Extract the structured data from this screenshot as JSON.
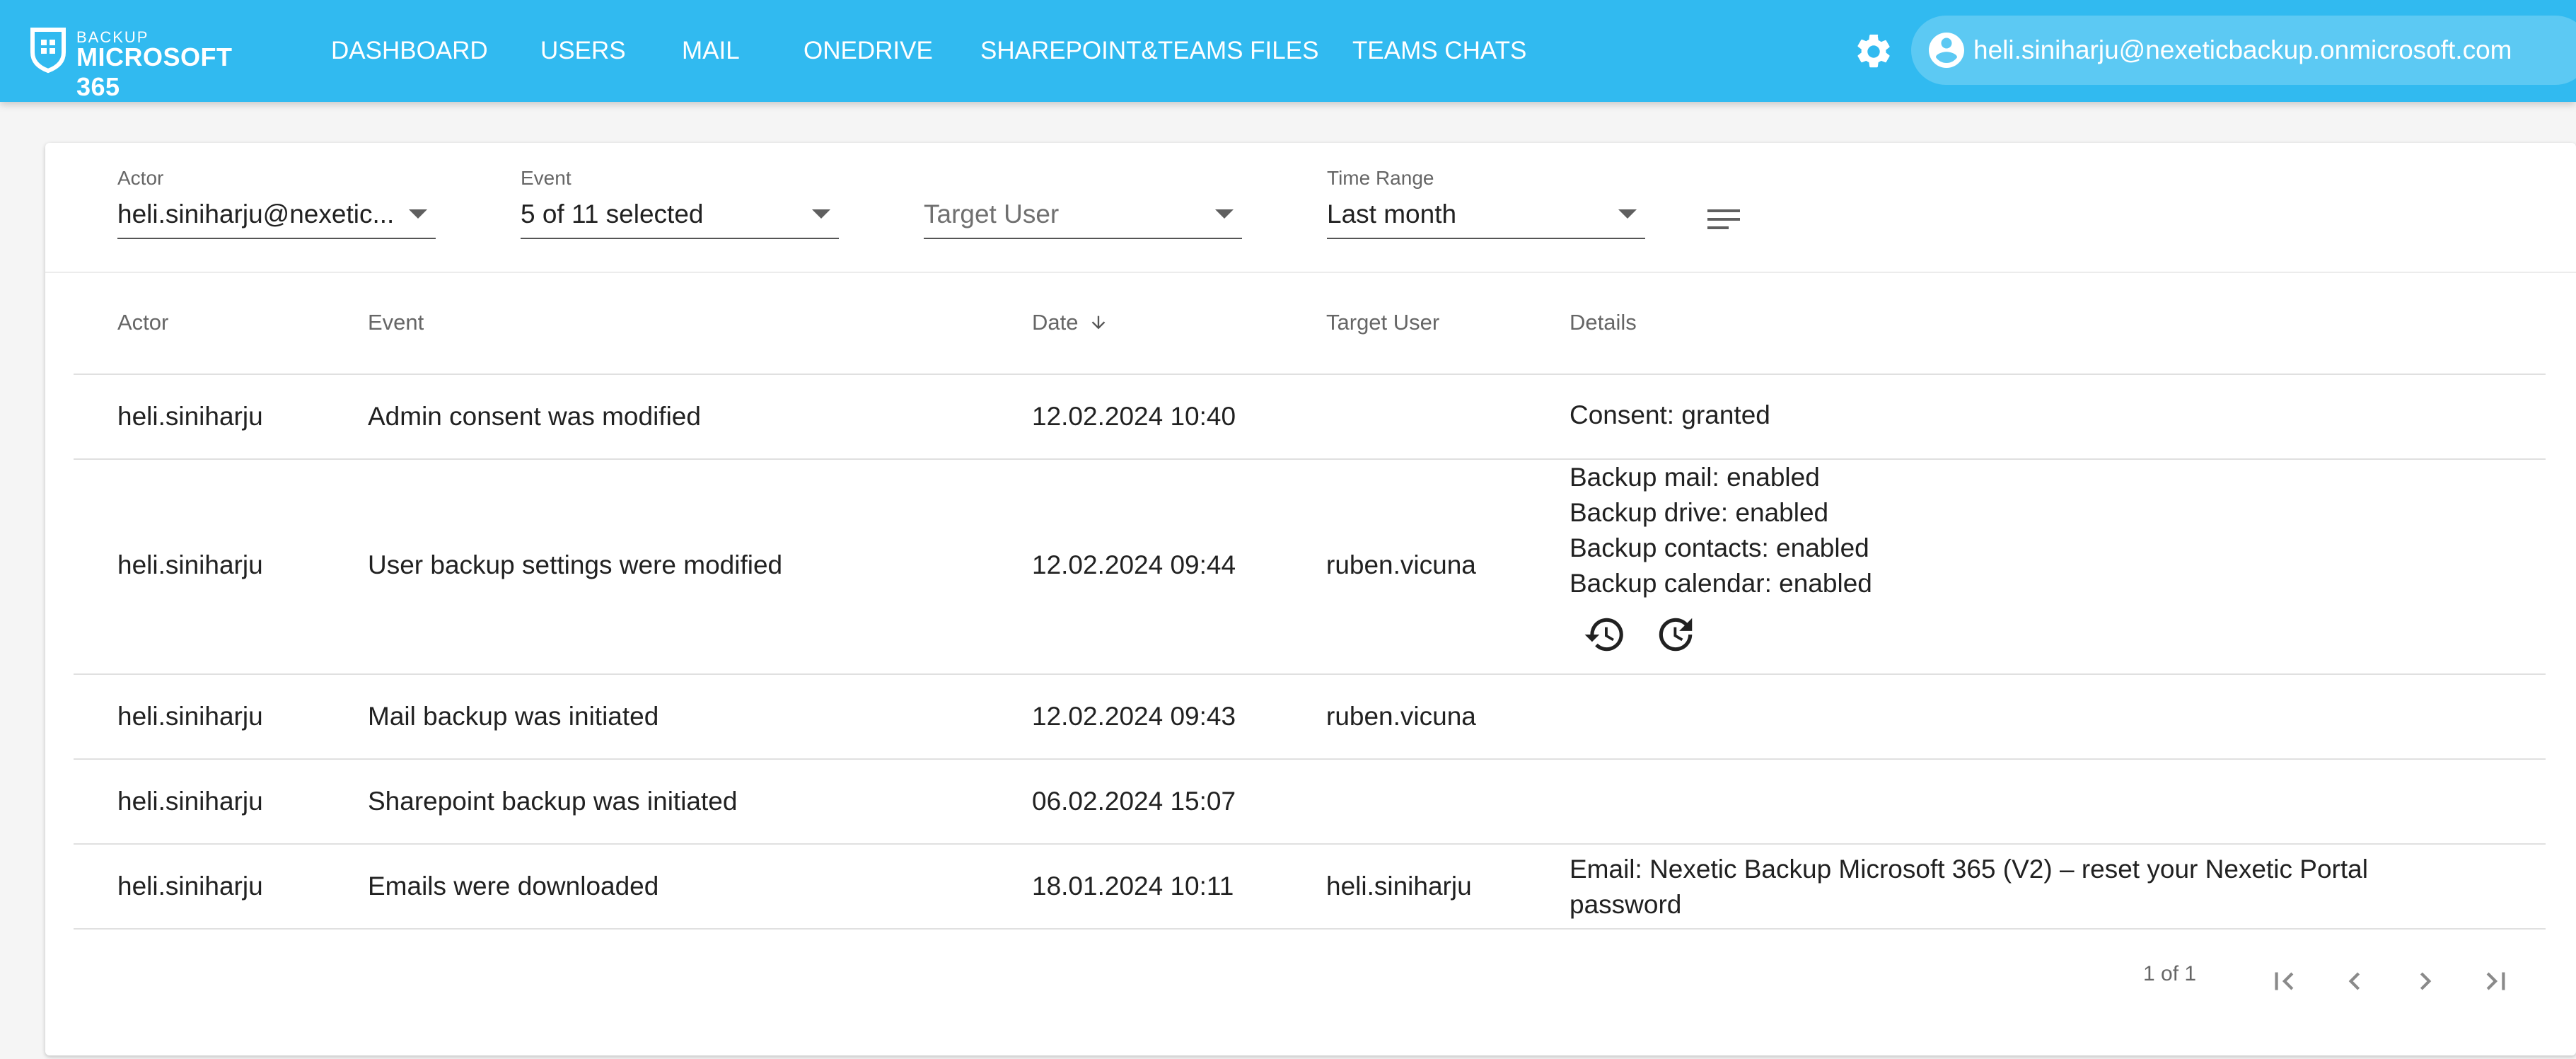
{
  "brand": {
    "sub": "BACKUP",
    "main": "MICROSOFT 365"
  },
  "nav": [
    "DASHBOARD",
    "USERS",
    "MAIL",
    "ONEDRIVE",
    "SHAREPOINT&TEAMS FILES",
    "TEAMS CHATS"
  ],
  "account": {
    "email": "heli.siniharju@nexeticbackup.onmicrosoft.com"
  },
  "filters": {
    "actor": {
      "label": "Actor",
      "value": "heli.siniharju@nexetic..."
    },
    "event": {
      "label": "Event",
      "value": "5 of 11 selected"
    },
    "target": {
      "label": "",
      "placeholder": "Target User"
    },
    "time": {
      "label": "Time Range",
      "value": "Last month"
    }
  },
  "table": {
    "headers": {
      "actor": "Actor",
      "event": "Event",
      "date": "Date",
      "target": "Target User",
      "details": "Details"
    },
    "sort_indicator": "arrow-down",
    "rows": [
      {
        "actor": "heli.siniharju",
        "event": "Admin consent was modified",
        "date": "12.02.2024 10:40",
        "target": "",
        "details": [
          "Consent: granted"
        ]
      },
      {
        "actor": "heli.siniharju",
        "event": "User backup settings were modified",
        "date": "12.02.2024 09:44",
        "target": "ruben.vicuna",
        "details": [
          "Backup mail: enabled",
          "Backup drive: enabled",
          "Backup contacts: enabled",
          "Backup calendar: enabled"
        ],
        "actions": [
          "history-icon",
          "restore-icon"
        ]
      },
      {
        "actor": "heli.siniharju",
        "event": "Mail backup was initiated",
        "date": "12.02.2024 09:43",
        "target": "ruben.vicuna",
        "details": []
      },
      {
        "actor": "heli.siniharju",
        "event": "Sharepoint backup was initiated",
        "date": "06.02.2024 15:07",
        "target": "",
        "details": []
      },
      {
        "actor": "heli.siniharju",
        "event": "Emails were downloaded",
        "date": "18.01.2024 10:11",
        "target": "heli.siniharju",
        "details": [
          "Email: Nexetic Backup Microsoft 365 (V2) – reset your Nexetic Portal",
          "password"
        ]
      }
    ]
  },
  "pagination": {
    "text": "1 of 1"
  },
  "colors": {
    "topbar": "#31baf0",
    "account_pill": "#5cc9f3"
  }
}
